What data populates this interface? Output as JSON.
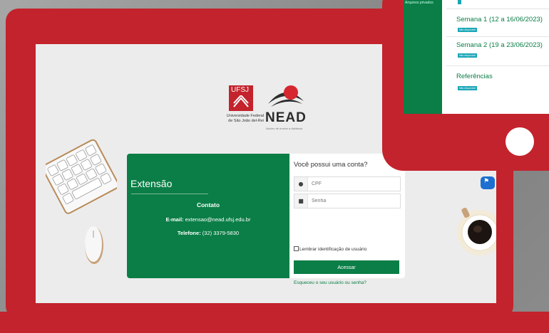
{
  "logo": {
    "ufsj": "UFSJ",
    "ufsj_name_line1": "Universidade Federal",
    "ufsj_name_line2": "de São João del-Rei",
    "nead": "NEAD",
    "nead_sub": "Núcleo de ensino a distância"
  },
  "contact": {
    "section_title": "Extensão",
    "heading": "Contato",
    "email_label": "E-mail:",
    "email_value": "extensao@nead.ufsj.edu.br",
    "phone_label": "Telefone:",
    "phone_value": "(32) 3379-5830"
  },
  "login": {
    "title": "Você possui uma conta?",
    "cpf_placeholder": "CPF",
    "senha_placeholder": "Senha",
    "remember_label": "Lembrar identificação de usuário",
    "submit_label": "Acessar",
    "forgot_link": "Esqueceu o seu usuário ou senha?"
  },
  "phone": {
    "sidebar_item": "Arquivos privados",
    "weeks": [
      {
        "title": "Semana 1 (12 a 16/06/2023)",
        "badge": "Não disponível"
      },
      {
        "title": "Semana 2 (19 a 23/06/2023)",
        "badge": "Não disponível"
      },
      {
        "title": "Referências",
        "badge": "Não disponível"
      }
    ]
  },
  "colors": {
    "brand_red": "#c3232c",
    "brand_green": "#0a7e46"
  }
}
